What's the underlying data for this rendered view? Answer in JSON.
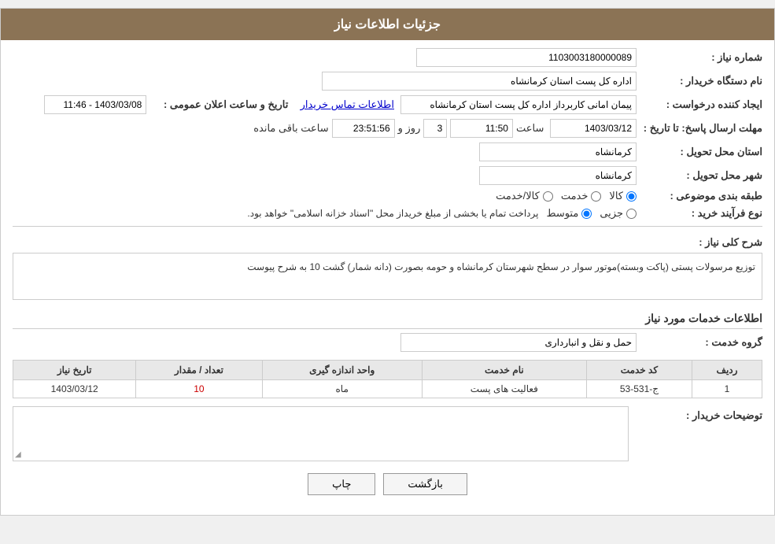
{
  "header": {
    "title": "جزئیات اطلاعات نیاز"
  },
  "fields": {
    "need_number_label": "شماره نیاز :",
    "need_number_value": "1103003180000089",
    "buyer_org_label": "نام دستگاه خریدار :",
    "buyer_org_value": "",
    "creator_label": "ایجاد کننده درخواست :",
    "creator_value": "پیمان امانی کاربرداز اداره کل پست استان کرمانشاه",
    "creator_link": "اطلاعات تماس خریدار",
    "announce_date_label": "تاریخ و ساعت اعلان عمومی :",
    "announce_date_value": "1403/03/08 - 11:46",
    "deadline_label": "مهلت ارسال پاسخ: تا تاریخ :",
    "deadline_date": "1403/03/12",
    "deadline_time": "11:50",
    "deadline_days": "3",
    "deadline_remaining": "23:51:56",
    "deadline_days_label": "روز و",
    "deadline_remaining_label": "ساعت باقی مانده",
    "province_label": "استان محل تحویل :",
    "province_value": "کرمانشاه",
    "city_label": "شهر محل تحویل :",
    "city_value": "کرمانشاه",
    "category_label": "طبقه بندی موضوعی :",
    "category_options": [
      "کالا",
      "خدمت",
      "کالا/خدمت"
    ],
    "category_selected": "کالا",
    "purchase_type_label": "نوع فرآیند خرید :",
    "purchase_options": [
      "جزیی",
      "متوسط"
    ],
    "purchase_selected": "متوسط",
    "purchase_note": "پرداخت تمام یا بخشی از مبلغ خریداز محل \"اسناد خزانه اسلامی\" خواهد بود.",
    "need_desc_label": "شرح کلی نیاز :",
    "need_desc": "توزیع مرسولات پستی (پاکت وبسته)موتور سوار در سطح شهرستان کرمانشاه و حومه بصورت (دانه شمار) گشت 10 به شرح پیوست",
    "services_title": "اطلاعات خدمات مورد نیاز",
    "service_group_label": "گروه خدمت :",
    "service_group_value": "حمل و نقل و انبارداری",
    "table_headers": {
      "row_num": "ردیف",
      "service_code": "کد خدمت",
      "service_name": "نام خدمت",
      "unit": "واحد اندازه گیری",
      "quantity": "تعداد / مقدار",
      "need_date": "تاریخ نیاز"
    },
    "table_rows": [
      {
        "row_num": "1",
        "service_code": "ج-531-53",
        "service_name": "فعالیت های پست",
        "unit": "ماه",
        "quantity": "10",
        "need_date": "1403/03/12"
      }
    ],
    "buyer_notes_label": "توضیحات خریدار :",
    "buyer_notes_value": "",
    "btn_print": "چاپ",
    "btn_back": "بازگشت",
    "org_value": "اداره کل پست استان کرمانشاه"
  }
}
